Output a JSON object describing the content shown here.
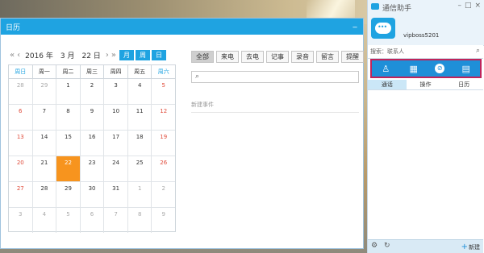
{
  "calendar": {
    "window_title": "日历",
    "year_text": "2016 年",
    "month_text": "3 月",
    "day_text": "22 日",
    "view_buttons": [
      "月",
      "周",
      "日"
    ],
    "weekdays": [
      "周日",
      "周一",
      "周二",
      "周三",
      "周四",
      "周五",
      "周六"
    ],
    "weeks": [
      [
        "28",
        "29",
        "1",
        "2",
        "3",
        "4",
        "5"
      ],
      [
        "6",
        "7",
        "8",
        "9",
        "10",
        "11",
        "12"
      ],
      [
        "13",
        "14",
        "15",
        "16",
        "17",
        "18",
        "19"
      ],
      [
        "20",
        "21",
        "22",
        "23",
        "24",
        "25",
        "26"
      ],
      [
        "27",
        "28",
        "29",
        "30",
        "31",
        "1",
        "2"
      ],
      [
        "3",
        "4",
        "5",
        "6",
        "7",
        "8",
        "9"
      ]
    ],
    "today": "22",
    "filters": [
      "全部",
      "来电",
      "去电",
      "记事",
      "录音",
      "留言",
      "提醒"
    ],
    "new_event_label": "新建事件",
    "colors": {
      "accent": "#1fa3e1",
      "today": "#f7941e",
      "weekend": "#e04b3a"
    }
  },
  "assistant": {
    "title": "通信助手",
    "username": "vipboss5201",
    "search_placeholder": "搜索：联系人",
    "func_icons": [
      "contacts-icon",
      "apps-grid-icon",
      "compass-icon",
      "calendar-grid-icon"
    ],
    "tabs": [
      "通话",
      "操作",
      "日历"
    ],
    "new_label": "新建"
  }
}
